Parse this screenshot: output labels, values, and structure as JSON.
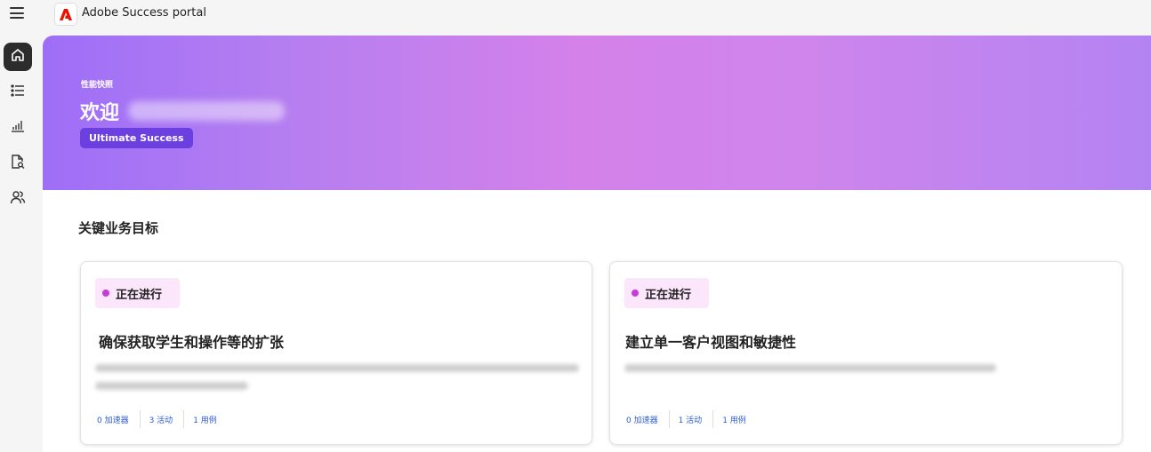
{
  "app": {
    "name": "Adobe Success portal",
    "logo_icon": "adobe-logo-icon",
    "brand_color": "#eb1000"
  },
  "sidebar": {
    "items": [
      {
        "icon": "home-icon",
        "active": true
      },
      {
        "icon": "list-icon",
        "active": false
      },
      {
        "icon": "bar-chart-icon",
        "active": false
      },
      {
        "icon": "document-search-icon",
        "active": false
      },
      {
        "icon": "users-icon",
        "active": false
      }
    ]
  },
  "hero": {
    "eyebrow": "性能快照",
    "welcome": "欢迎",
    "plan_badge": "Ultimate Success"
  },
  "section": {
    "title": "关键业务目标"
  },
  "cards": [
    {
      "status": "正在进行",
      "title": "确保获取学生和操作等的扩张",
      "stats": {
        "accelerators": "0 加速器",
        "activities": "3 活动",
        "cases": "1 用例"
      }
    },
    {
      "status": "正在进行",
      "title": "建立单一客户视图和敏捷性",
      "stats": {
        "accelerators": "0 加速器",
        "activities": "1 活动",
        "cases": "1 用例"
      }
    }
  ],
  "colors": {
    "status_dot": "#c23ed6",
    "status_bg": "#fbe6fb",
    "badge_bg": "#6b3fe0",
    "link": "#2b5bd7"
  }
}
